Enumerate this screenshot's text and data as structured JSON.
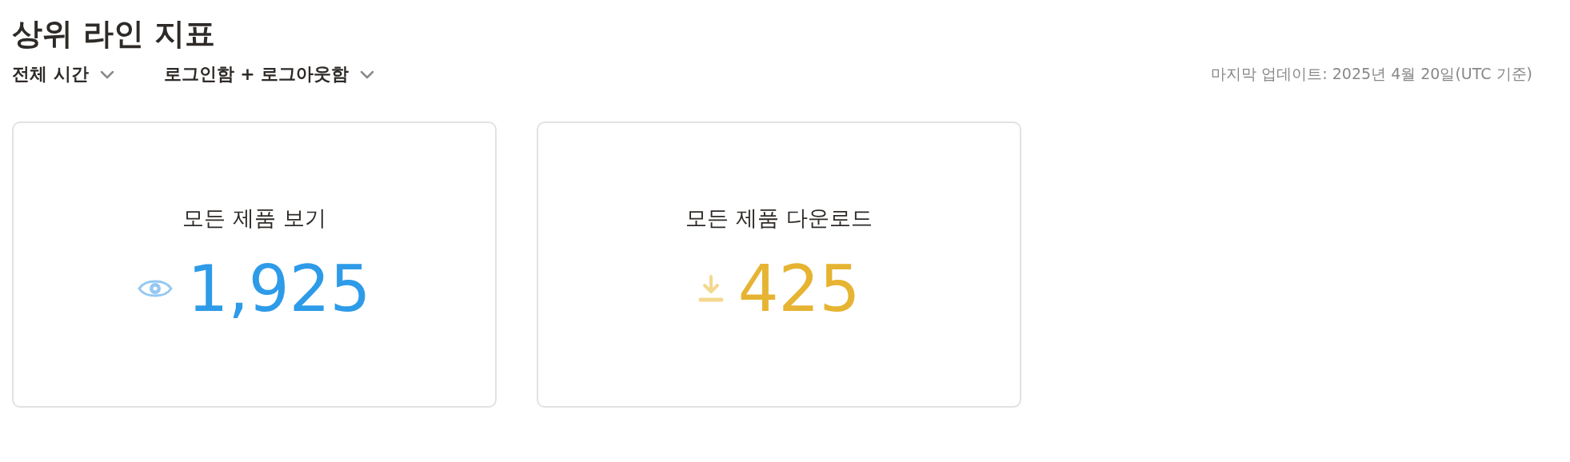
{
  "title": "상위 라인 지표",
  "filters": [
    {
      "label": "전체 시간"
    },
    {
      "label": "로그인함 + 로그아웃함"
    }
  ],
  "last_updated": "마지막 업데이트: 2025년 4월 20일(UTC 기준)",
  "cards": [
    {
      "kind": "views",
      "title": "모든 제품 보기",
      "value": "1,925",
      "color": "#2d9be8"
    },
    {
      "kind": "downloads",
      "title": "모든 제품 다운로드",
      "value": "425",
      "color": "#e6b432"
    }
  ]
}
